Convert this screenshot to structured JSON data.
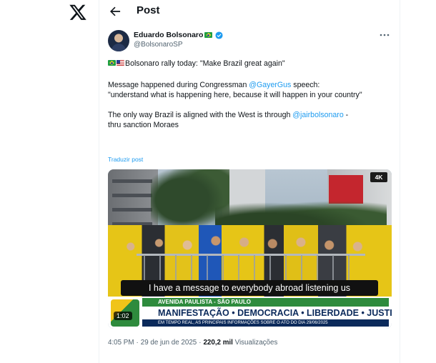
{
  "header": {
    "title": "Post",
    "back_icon": "arrow-left-icon",
    "logo_icon": "x-logo-icon"
  },
  "author": {
    "display_name": "Eduardo Bolsonaro",
    "handle": "@BolsonaroSP",
    "name_flag": "brazil-flag-icon",
    "verified_icon": "verified-badge-icon",
    "verified_color": "#1d9bf0"
  },
  "tweet": {
    "line1_text": "Bolsonaro rally today: \"Make Brazil great again\"",
    "para2_part1": "Message happened during Congressman ",
    "para2_mention": "@GayerGus",
    "para2_part2": " speech:\n\"understand what is happening here, because it will happen in your country\"",
    "para3_part1": "The only way Brazil is aligned with the West is through ",
    "para3_mention": "@jairbolsonaro",
    "para3_part2": " -\nthru sanction Moraes",
    "translate_label": "Traduzir post"
  },
  "media": {
    "quality_badge": "4K",
    "caption": "I have a message to everybody abroad listening us",
    "lower_third_sub": "AVENIDA PAULISTA - SÃO PAULO",
    "lower_third_title": "MANIFESTAÇÃO • DEMOCRACIA • LIBERDADE • JUSTIÇA",
    "lower_third_ticker": "EM TEMPO REAL, AS PRINCIPAIS INFORMAÇÕES SOBRE O ATO DO DIA 29/06/2025",
    "duration": "1:02"
  },
  "meta": {
    "time": "4:05 PM",
    "date": "29 de jun de 2025",
    "views_count": "220,2 mil",
    "views_label": "Visualizações"
  },
  "colors": {
    "accent": "#1d9bf0",
    "text_primary": "#0f1419",
    "text_secondary": "#536471"
  }
}
